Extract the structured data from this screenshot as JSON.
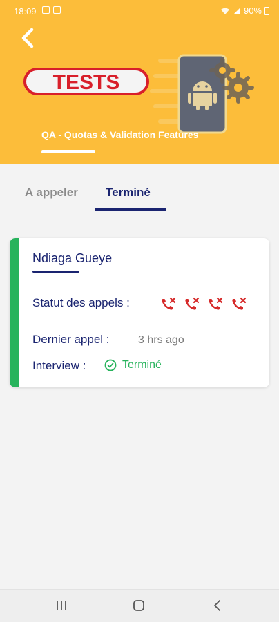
{
  "status_bar": {
    "time": "18:09",
    "battery": "90%"
  },
  "header": {
    "banner_text": "TESTS",
    "title": "QA - Quotas & Validation Features"
  },
  "tabs": [
    {
      "label": "A appeler",
      "active": false
    },
    {
      "label": "Terminé",
      "active": true
    }
  ],
  "card": {
    "name": "Ndiaga Gueye",
    "status_label": "Statut des appels :",
    "status_icons": [
      "missed-call-icon",
      "missed-call-icon",
      "missed-call-icon",
      "missed-call-icon"
    ],
    "last_call_label": "Dernier appel :",
    "last_call_value": "3 hrs ago",
    "interview_label": "Interview :",
    "interview_value": "Terminé"
  },
  "colors": {
    "header_bg": "#fcbd3a",
    "accent": "#1a2470",
    "success": "#27b35c",
    "missed": "#d62a2a"
  },
  "nav_icons": [
    "recent-apps-icon",
    "home-icon",
    "back-icon"
  ]
}
